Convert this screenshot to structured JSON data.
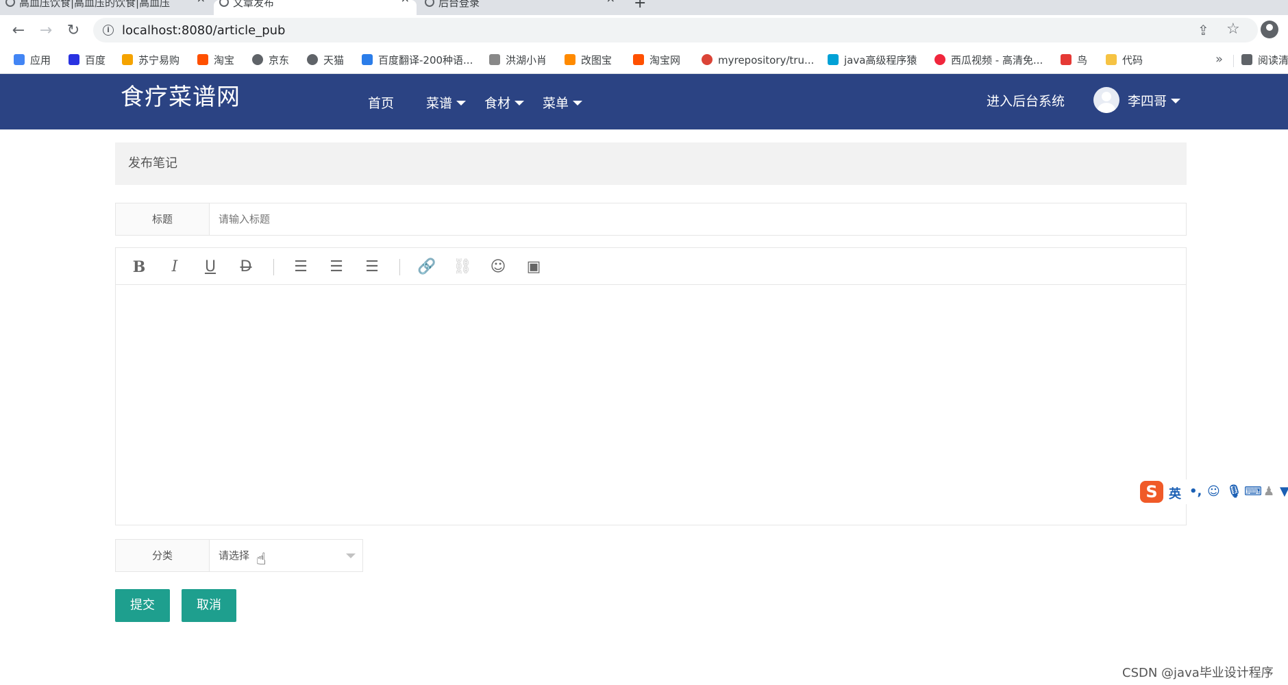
{
  "browser": {
    "tabs": [
      {
        "title": "高血压饮食|高血压的饮食|高血压"
      },
      {
        "title": "文章发布"
      },
      {
        "title": "后台登录"
      }
    ],
    "url": "localhost:8080/article_pub",
    "bookmarks": [
      {
        "label": "应用",
        "color": "#4285f4"
      },
      {
        "label": "百度",
        "color": "#2932e1"
      },
      {
        "label": "苏宁易购",
        "color": "#f5a300"
      },
      {
        "label": "淘宝",
        "color": "#ff5000"
      },
      {
        "label": "京东",
        "color": "#5f6368"
      },
      {
        "label": "天猫",
        "color": "#5f6368"
      },
      {
        "label": "百度翻译-200种语...",
        "color": "#2b7de9"
      },
      {
        "label": "洪湖小肖",
        "color": "#888888"
      },
      {
        "label": "改图宝",
        "color": "#ff8a00"
      },
      {
        "label": "淘宝网",
        "color": "#ff5000"
      },
      {
        "label": "myrepository/tru...",
        "color": "#db4437"
      },
      {
        "label": "java高级程序猿",
        "color": "#00a1d6"
      },
      {
        "label": "西瓜视频 - 高清免...",
        "color": "#f0263c"
      },
      {
        "label": "鸟",
        "color": "#e53935"
      },
      {
        "label": "代码",
        "color": "#f6c343"
      },
      {
        "label": "阅读清",
        "color": "#5f6368"
      }
    ]
  },
  "header": {
    "logo": "食疗菜谱网",
    "nav": [
      {
        "label": "首页"
      },
      {
        "label": "菜谱"
      },
      {
        "label": "食材"
      },
      {
        "label": "菜单"
      }
    ],
    "admin_link": "进入后台系统",
    "username": "李四哥"
  },
  "form": {
    "panel_title": "发布笔记",
    "title_label": "标题",
    "title_placeholder": "请输入标题",
    "title_value": "",
    "category_label": "分类",
    "category_value": "请选择",
    "submit_label": "提交",
    "cancel_label": "取消"
  },
  "editor": {
    "toolbar": [
      "bold-icon",
      "italic-icon",
      "underline-icon",
      "strikethrough-icon",
      "align-left-icon",
      "align-center-icon",
      "align-right-icon",
      "link-icon",
      "unlink-icon",
      "emoji-icon",
      "image-icon"
    ],
    "content": ""
  },
  "ime": {
    "mode": "英"
  },
  "watermark": "CSDN @java毕业设计程序"
}
